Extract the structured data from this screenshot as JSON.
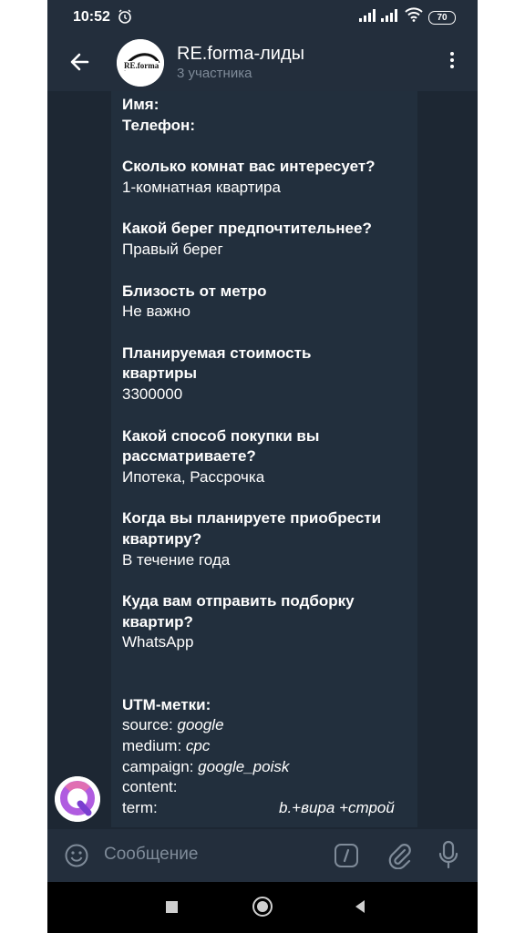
{
  "status": {
    "time": "10:52",
    "battery": "70"
  },
  "header": {
    "title": "RE.forma-лиды",
    "subtitle": "3 участника",
    "avatar_logo": "RE.forma"
  },
  "message": {
    "lines": {
      "name": "Имя:",
      "phone": "Телефон:",
      "q1": "Сколько комнат вас интересует?",
      "a1": "1-комнатная квартира",
      "q2": "Какой берег предпочтительнее?",
      "a2": "Правый берег",
      "q3": "Близость от метро",
      "a3": "Не важно",
      "q4_1": "Планируемая стоимость",
      "q4_2": "квартиры",
      "a4": "3300000",
      "q5_1": "Какой способ покупки вы",
      "q5_2": "рассматриваете?",
      "a5": "Ипотека, Рассрочка",
      "q6_1": "Когда вы планируете приобрести",
      "q6_2": "квартиру?",
      "a6": "В течение года",
      "q7_1": "Куда вам отправить подборку",
      "q7_2": "квартир?",
      "a7": "WhatsApp"
    },
    "utm": {
      "title": "UTM-метки:",
      "source_label": "source: ",
      "source_value": "google",
      "medium_label": "medium: ",
      "medium_value": "cpc",
      "campaign_label": "campaign: ",
      "campaign_value": "google_poisk",
      "content_label": "content:",
      "term_label": "term:",
      "term_value": "b.+вира +строй"
    }
  },
  "input": {
    "placeholder": "Сообщение"
  },
  "icons": {
    "back": "arrow-left-icon",
    "menu": "more-vertical-icon",
    "emoji": "emoji-icon",
    "command": "command-icon",
    "attach": "paperclip-icon",
    "mic": "microphone-icon"
  },
  "colors": {
    "background": "#1d2733",
    "header": "#232e3c",
    "bubble": "#222f3d",
    "muted": "#7f8b99"
  }
}
